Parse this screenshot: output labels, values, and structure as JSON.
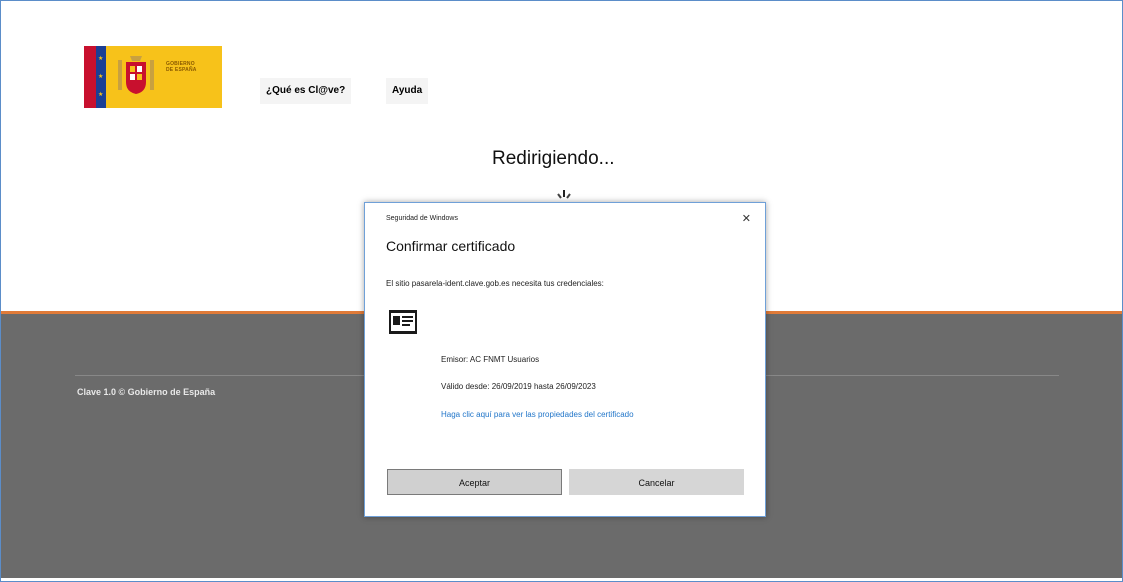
{
  "logo": {
    "text_line1": "GOBIERNO",
    "text_line2": "DE ESPAÑA"
  },
  "nav": {
    "items": [
      {
        "label": "¿Qué es Cl@ve?"
      },
      {
        "label": "Ayuda"
      }
    ]
  },
  "status": {
    "redirecting": "Redirigiendo..."
  },
  "footer": {
    "copyright": "Clave 1.0 © Gobierno de España"
  },
  "dialog": {
    "caption": "Seguridad de Windows",
    "close_glyph": "✕",
    "title": "Confirmar certificado",
    "message": "El sitio pasarela-ident.clave.gob.es necesita tus credenciales:",
    "emisor": "Emisor: AC FNMT Usuarios",
    "valido": "Válido desde: 26/09/2019 hasta 26/09/2023",
    "link": "Haga clic aquí para ver las propiedades del certificado",
    "accept_label": "Aceptar",
    "cancel_label": "Cancelar"
  },
  "colors": {
    "footer_bg": "#6b6b6b",
    "accent_orange": "#e07b39",
    "link_blue": "#2276c9",
    "logo_yellow": "#f7c21a"
  },
  "icons": {
    "logo_shield": "coat-of-arms-icon",
    "certificate": "certificate-card-icon",
    "close": "close-icon",
    "spinner": "loading-spinner-icon"
  }
}
